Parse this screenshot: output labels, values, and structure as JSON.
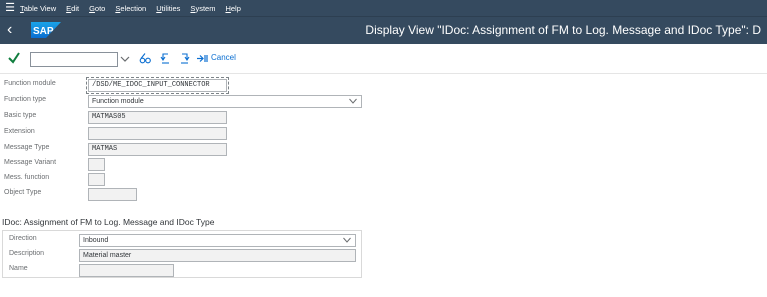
{
  "menubar": {
    "items": [
      "Table View",
      "Edit",
      "Goto",
      "Selection",
      "Utilities",
      "System",
      "Help"
    ]
  },
  "titlebar": {
    "logo": "SAP",
    "title": "Display View \"IDoc: Assignment of FM to Log. Message and IDoc Type\": D"
  },
  "toolbar": {
    "command_value": "",
    "cancel_label": "Cancel"
  },
  "form": {
    "function_module": {
      "label": "Function module",
      "value": "/DSD/ME_IDOC_INPUT_CONNECTOR"
    },
    "function_type": {
      "label": "Function type",
      "value": "Function module"
    },
    "basic_type": {
      "label": "Basic type",
      "value": "MATMAS05"
    },
    "extension": {
      "label": "Extension",
      "value": ""
    },
    "message_type": {
      "label": "Message Type",
      "value": "MATMAS"
    },
    "message_variant": {
      "label": "Message Variant",
      "value": ""
    },
    "mess_function": {
      "label": "Mess. function",
      "value": ""
    },
    "object_type": {
      "label": "Object Type",
      "value": ""
    }
  },
  "section": {
    "title": "IDoc: Assignment of FM to Log. Message and IDoc Type",
    "direction": {
      "label": "Direction",
      "value": "Inbound"
    },
    "description": {
      "label": "Description",
      "value": "Material master"
    },
    "name": {
      "label": "Name",
      "value": ""
    }
  },
  "colors": {
    "shell": "#354a5f",
    "accent": "#0a6ed1",
    "check": "#107e3e"
  }
}
